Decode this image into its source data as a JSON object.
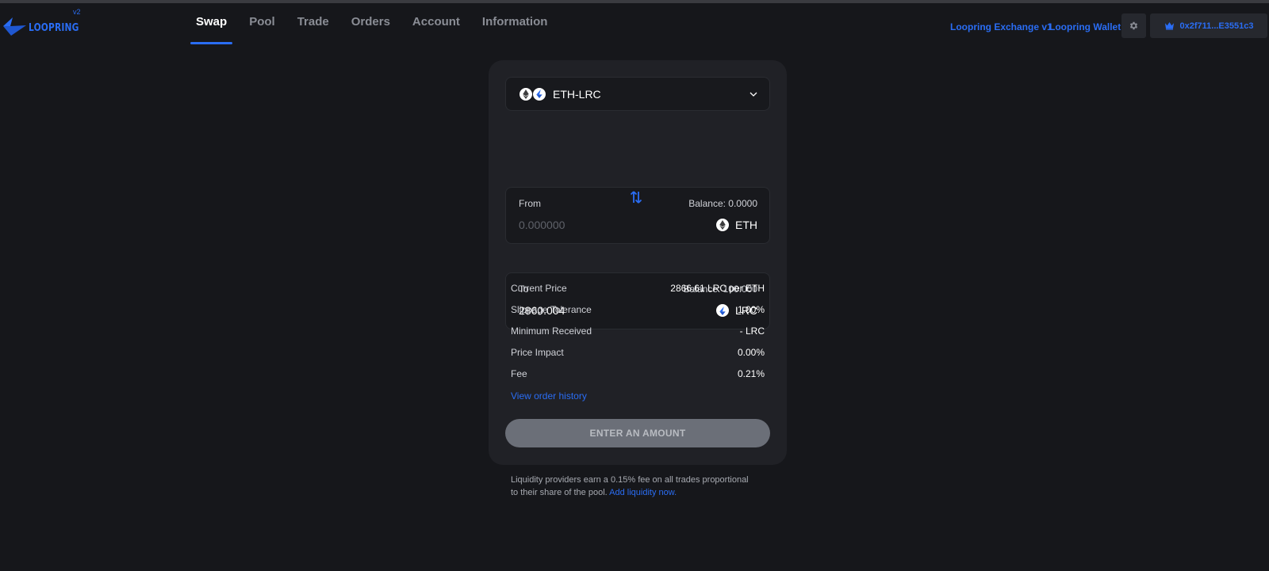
{
  "brand": {
    "name": "LOOPRING",
    "version": "v2",
    "accent": "#2a6df4"
  },
  "nav": [
    {
      "label": "Swap",
      "active": true
    },
    {
      "label": "Pool"
    },
    {
      "label": "Trade"
    },
    {
      "label": "Orders"
    },
    {
      "label": "Account"
    },
    {
      "label": "Information"
    }
  ],
  "header": {
    "exchange_link": "Loopring Exchange v1",
    "wallet_link": "Loopring Wallet",
    "settings_icon": "gear-icon",
    "wallet_address": "0x2f711...E3551c3"
  },
  "swap": {
    "pair": "ETH-LRC",
    "from": {
      "label": "From",
      "balance": "Balance: 0.0000",
      "placeholder": "0.000000",
      "value": "",
      "token": "ETH"
    },
    "to": {
      "label": "To",
      "balance": "Balance: 100.000",
      "value": "2860.004",
      "token": "LRC"
    },
    "details": [
      {
        "key": "Current Price",
        "value": "2866.61 LRC per ETH"
      },
      {
        "key": "Slippage Tolerance",
        "value": "1.00%"
      },
      {
        "key": "Minimum Received",
        "value": "- LRC"
      },
      {
        "key": "Price Impact",
        "value": "0.00%"
      },
      {
        "key": "Fee",
        "value": "0.21%"
      }
    ],
    "order_history_link": "View order history",
    "submit_label": "ENTER AN AMOUNT"
  },
  "footnote": {
    "text": "Liquidity providers earn a 0.15% fee on all trades proportional to their share of the pool.",
    "link": "Add liquidity now."
  }
}
